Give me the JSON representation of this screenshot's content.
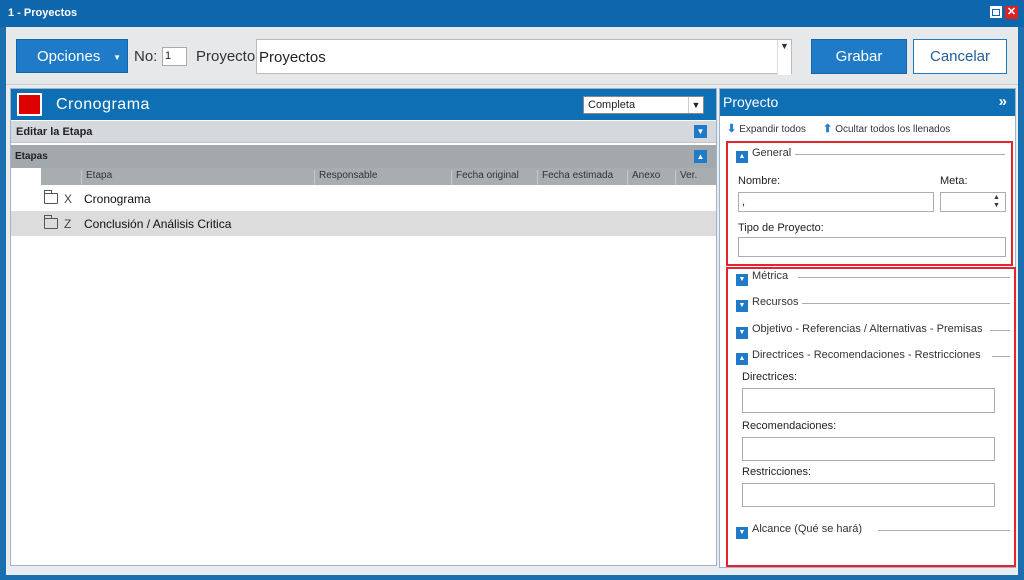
{
  "window": {
    "title": "1 - Proyectos"
  },
  "toolbar": {
    "opciones_label": "Opciones",
    "no_label": "No:",
    "no_value": "1",
    "proyecto_label": "Proyecto",
    "proyecto_value": "Proyectos",
    "grabar_label": "Grabar",
    "cancelar_label": "Cancelar"
  },
  "cronograma": {
    "title": "Cronograma",
    "view_select": "Completa",
    "editar_label": "Editar la Etapa",
    "etapas_label": "Etapas",
    "columns": [
      "Etapa",
      "Responsable",
      "Fecha original",
      "Fecha estimada",
      "Anexo",
      "Ver."
    ],
    "rows": [
      {
        "code": "X",
        "name": "Cronograma"
      },
      {
        "code": "Z",
        "name": "Conclusión / Análisis Critica"
      }
    ]
  },
  "proyecto_panel": {
    "title": "Proyecto",
    "expand_label": "Expandir todos",
    "hide_label": "Ocultar todos los llenados",
    "general": {
      "title": "General",
      "nombre_label": "Nombre:",
      "nombre_value": ",",
      "meta_label": "Meta:",
      "tipo_label": "Tipo de Proyecto:"
    },
    "sections": {
      "metrica": "Métrica",
      "recursos": "Recursos",
      "objetivo": "Objetivo - Referencias / Alternativas - Premisas",
      "directrices": "Directrices - Recomendaciones - Restricciones",
      "alcance": "Alcance (Qué se hará)"
    },
    "directrices_fields": {
      "directrices_label": "Directrices:",
      "recomendaciones_label": "Recomendaciones:",
      "restricciones_label": "Restricciones:"
    }
  },
  "colors": {
    "accent": "#1f7bc7",
    "header": "#0e6fb5",
    "highlight_box": "#e5242f",
    "status_red": "#dd0000"
  }
}
